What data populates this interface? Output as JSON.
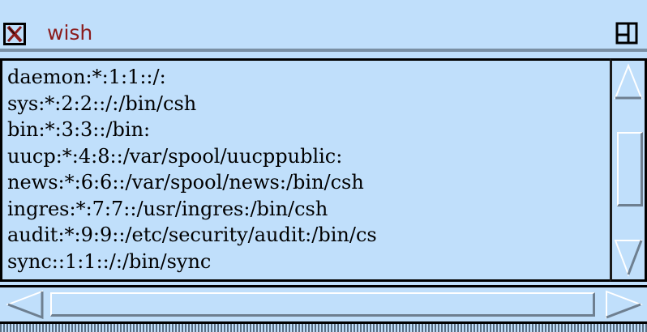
{
  "window": {
    "title": "wish",
    "close_icon": "x-close-icon",
    "maximize_icon": "maximize-icon"
  },
  "text": {
    "lines": [
      "daemon:*:1:1::/:",
      "sys:*:2:2::/:/bin/csh",
      "bin:*:3:3::/bin:",
      "uucp:*:4:8::/var/spool/uucppublic:",
      "news:*:6:6::/var/spool/news:/bin/csh",
      "ingres:*:7:7::/usr/ingres:/bin/csh",
      "audit:*:9:9::/etc/security/audit:/bin/cs",
      "sync::1:1::/:/bin/sync"
    ]
  },
  "scrollbars": {
    "vertical": {
      "up_icon": "arrow-up-icon",
      "down_icon": "arrow-down-icon"
    },
    "horizontal": {
      "left_icon": "arrow-left-icon",
      "right_icon": "arrow-right-icon"
    }
  },
  "colors": {
    "background": "#c0dffb",
    "title_text": "#8b1c1c",
    "text": "#000000"
  }
}
